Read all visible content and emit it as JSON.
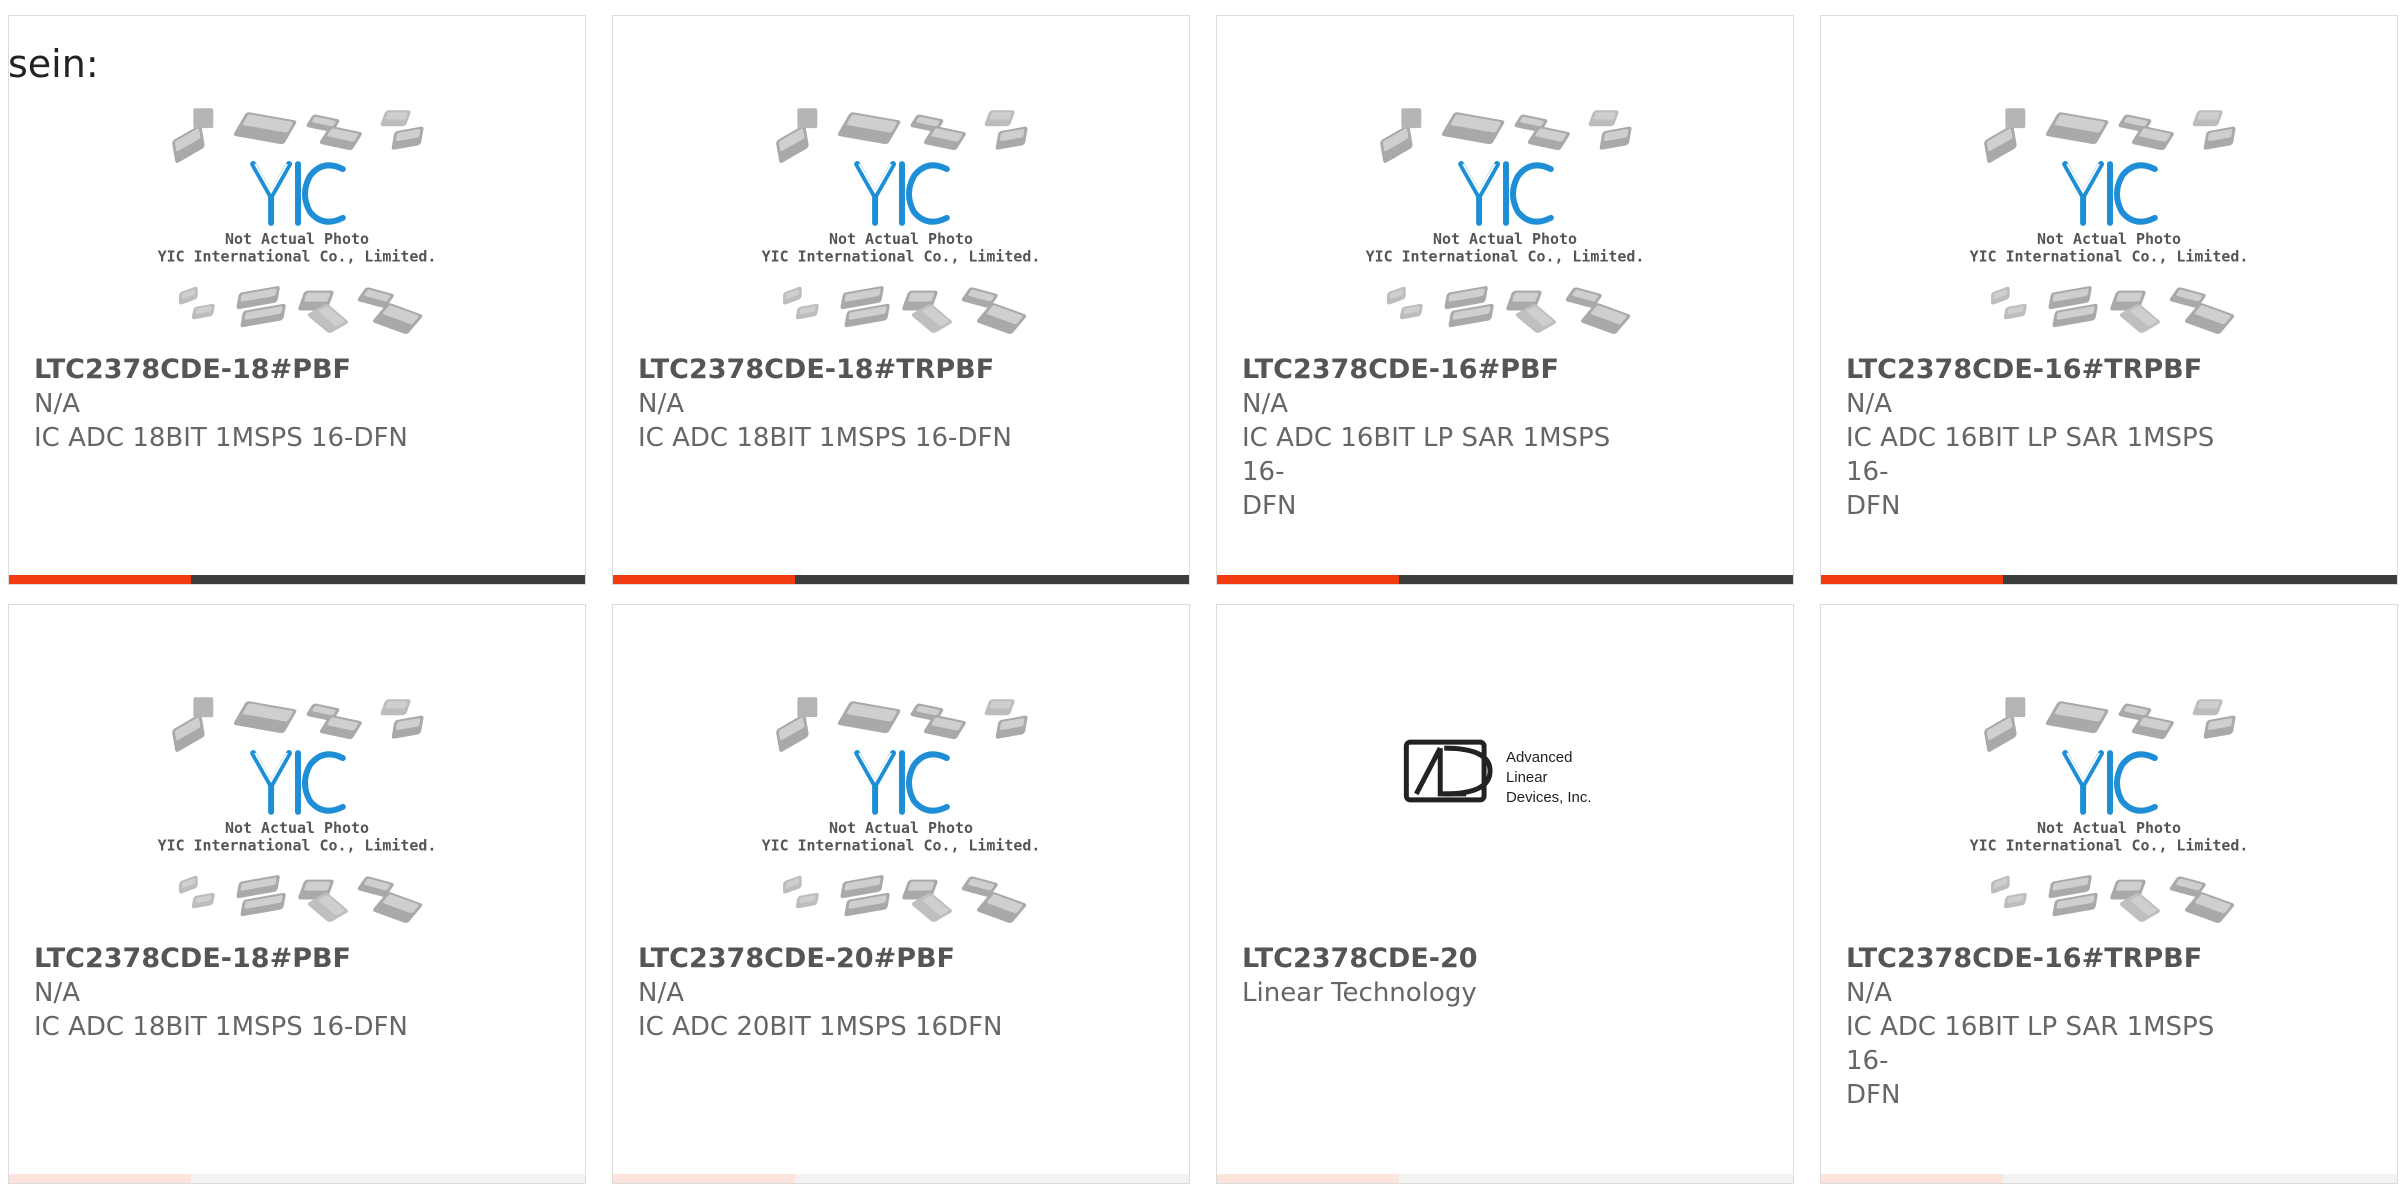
{
  "intro_text": "sein:",
  "placeholder": {
    "line1": "Not Actual Photo",
    "line2": "YIC International Co., Limited.",
    "logo_text": "YIC"
  },
  "adl_logo": {
    "line1": "Advanced",
    "line2": "Linear",
    "line3": "Devices, Inc."
  },
  "colors": {
    "accent": "#f03c10",
    "bar": "#3d3d3d",
    "logo_blue": "#1e8fd6"
  },
  "products": [
    {
      "part": "LTC2378CDE-18#PBF",
      "line1": "N/A",
      "line2": "IC ADC 18BIT 1MSPS 16-DFN",
      "line3": "",
      "image": "yic-placeholder"
    },
    {
      "part": "LTC2378CDE-18#TRPBF",
      "line1": "N/A",
      "line2": "IC ADC 18BIT 1MSPS 16-DFN",
      "line3": "",
      "image": "yic-placeholder"
    },
    {
      "part": "LTC2378CDE-16#PBF",
      "line1": "N/A",
      "line2": "IC ADC 16BIT LP SAR 1MSPS 16-",
      "line3": "DFN",
      "image": "yic-placeholder"
    },
    {
      "part": "LTC2378CDE-16#TRPBF",
      "line1": "N/A",
      "line2": "IC ADC 16BIT LP SAR 1MSPS 16-",
      "line3": "DFN",
      "image": "yic-placeholder"
    },
    {
      "part": "LTC2378CDE-18#PBF",
      "line1": "N/A",
      "line2": "IC ADC 18BIT 1MSPS 16-DFN",
      "line3": "",
      "image": "yic-placeholder"
    },
    {
      "part": "LTC2378CDE-20#PBF",
      "line1": "N/A",
      "line2": "IC ADC 20BIT 1MSPS 16DFN",
      "line3": "",
      "image": "yic-placeholder"
    },
    {
      "part": "LTC2378CDE-20",
      "line1": "Linear Technology",
      "line2": "",
      "line3": "",
      "image": "adl-logo"
    },
    {
      "part": "LTC2378CDE-16#TRPBF",
      "line1": "N/A",
      "line2": "IC ADC 16BIT LP SAR 1MSPS 16-",
      "line3": "DFN",
      "image": "yic-placeholder"
    }
  ]
}
